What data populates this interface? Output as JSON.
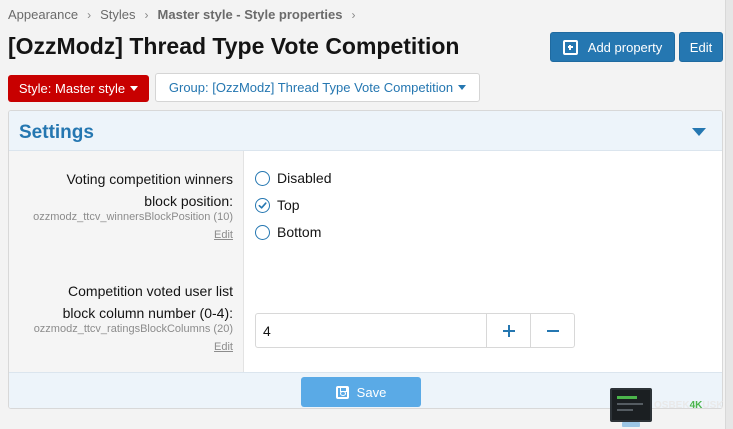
{
  "breadcrumb": {
    "items": [
      "Appearance",
      "Styles",
      "Master style - Style properties"
    ]
  },
  "page": {
    "title": "[OzzModz] Thread Type Vote Competition"
  },
  "header_buttons": {
    "add_property": "Add property",
    "edit": "Edit"
  },
  "filters": {
    "style_button": "Style: Master style",
    "group_button": "Group: [OzzModz] Thread Type Vote Competition"
  },
  "settings": {
    "title": "Settings",
    "rows": [
      {
        "label_line1": "Voting competition winners",
        "label_line2": "block position:",
        "key": "ozzmodz_ttcv_winnersBlockPosition (10)",
        "edit": "Edit",
        "type": "radio",
        "options": [
          {
            "label": "Disabled",
            "selected": false
          },
          {
            "label": "Top",
            "selected": true
          },
          {
            "label": "Bottom",
            "selected": false
          }
        ]
      },
      {
        "label_line1": "Competition voted user list",
        "label_line2": "block column number (0-4):",
        "key": "ozzmodz_ttcv_ratingsBlockColumns (20)",
        "edit": "Edit",
        "type": "number",
        "value": "4"
      }
    ],
    "save_label": "Save"
  },
  "watermark": {
    "text_a": "OSBEK",
    "text_b": "4K",
    "text_c": "USK"
  },
  "colors": {
    "accent": "#2577b1",
    "style_button": "#c80000",
    "save_button": "#5aaae6"
  }
}
